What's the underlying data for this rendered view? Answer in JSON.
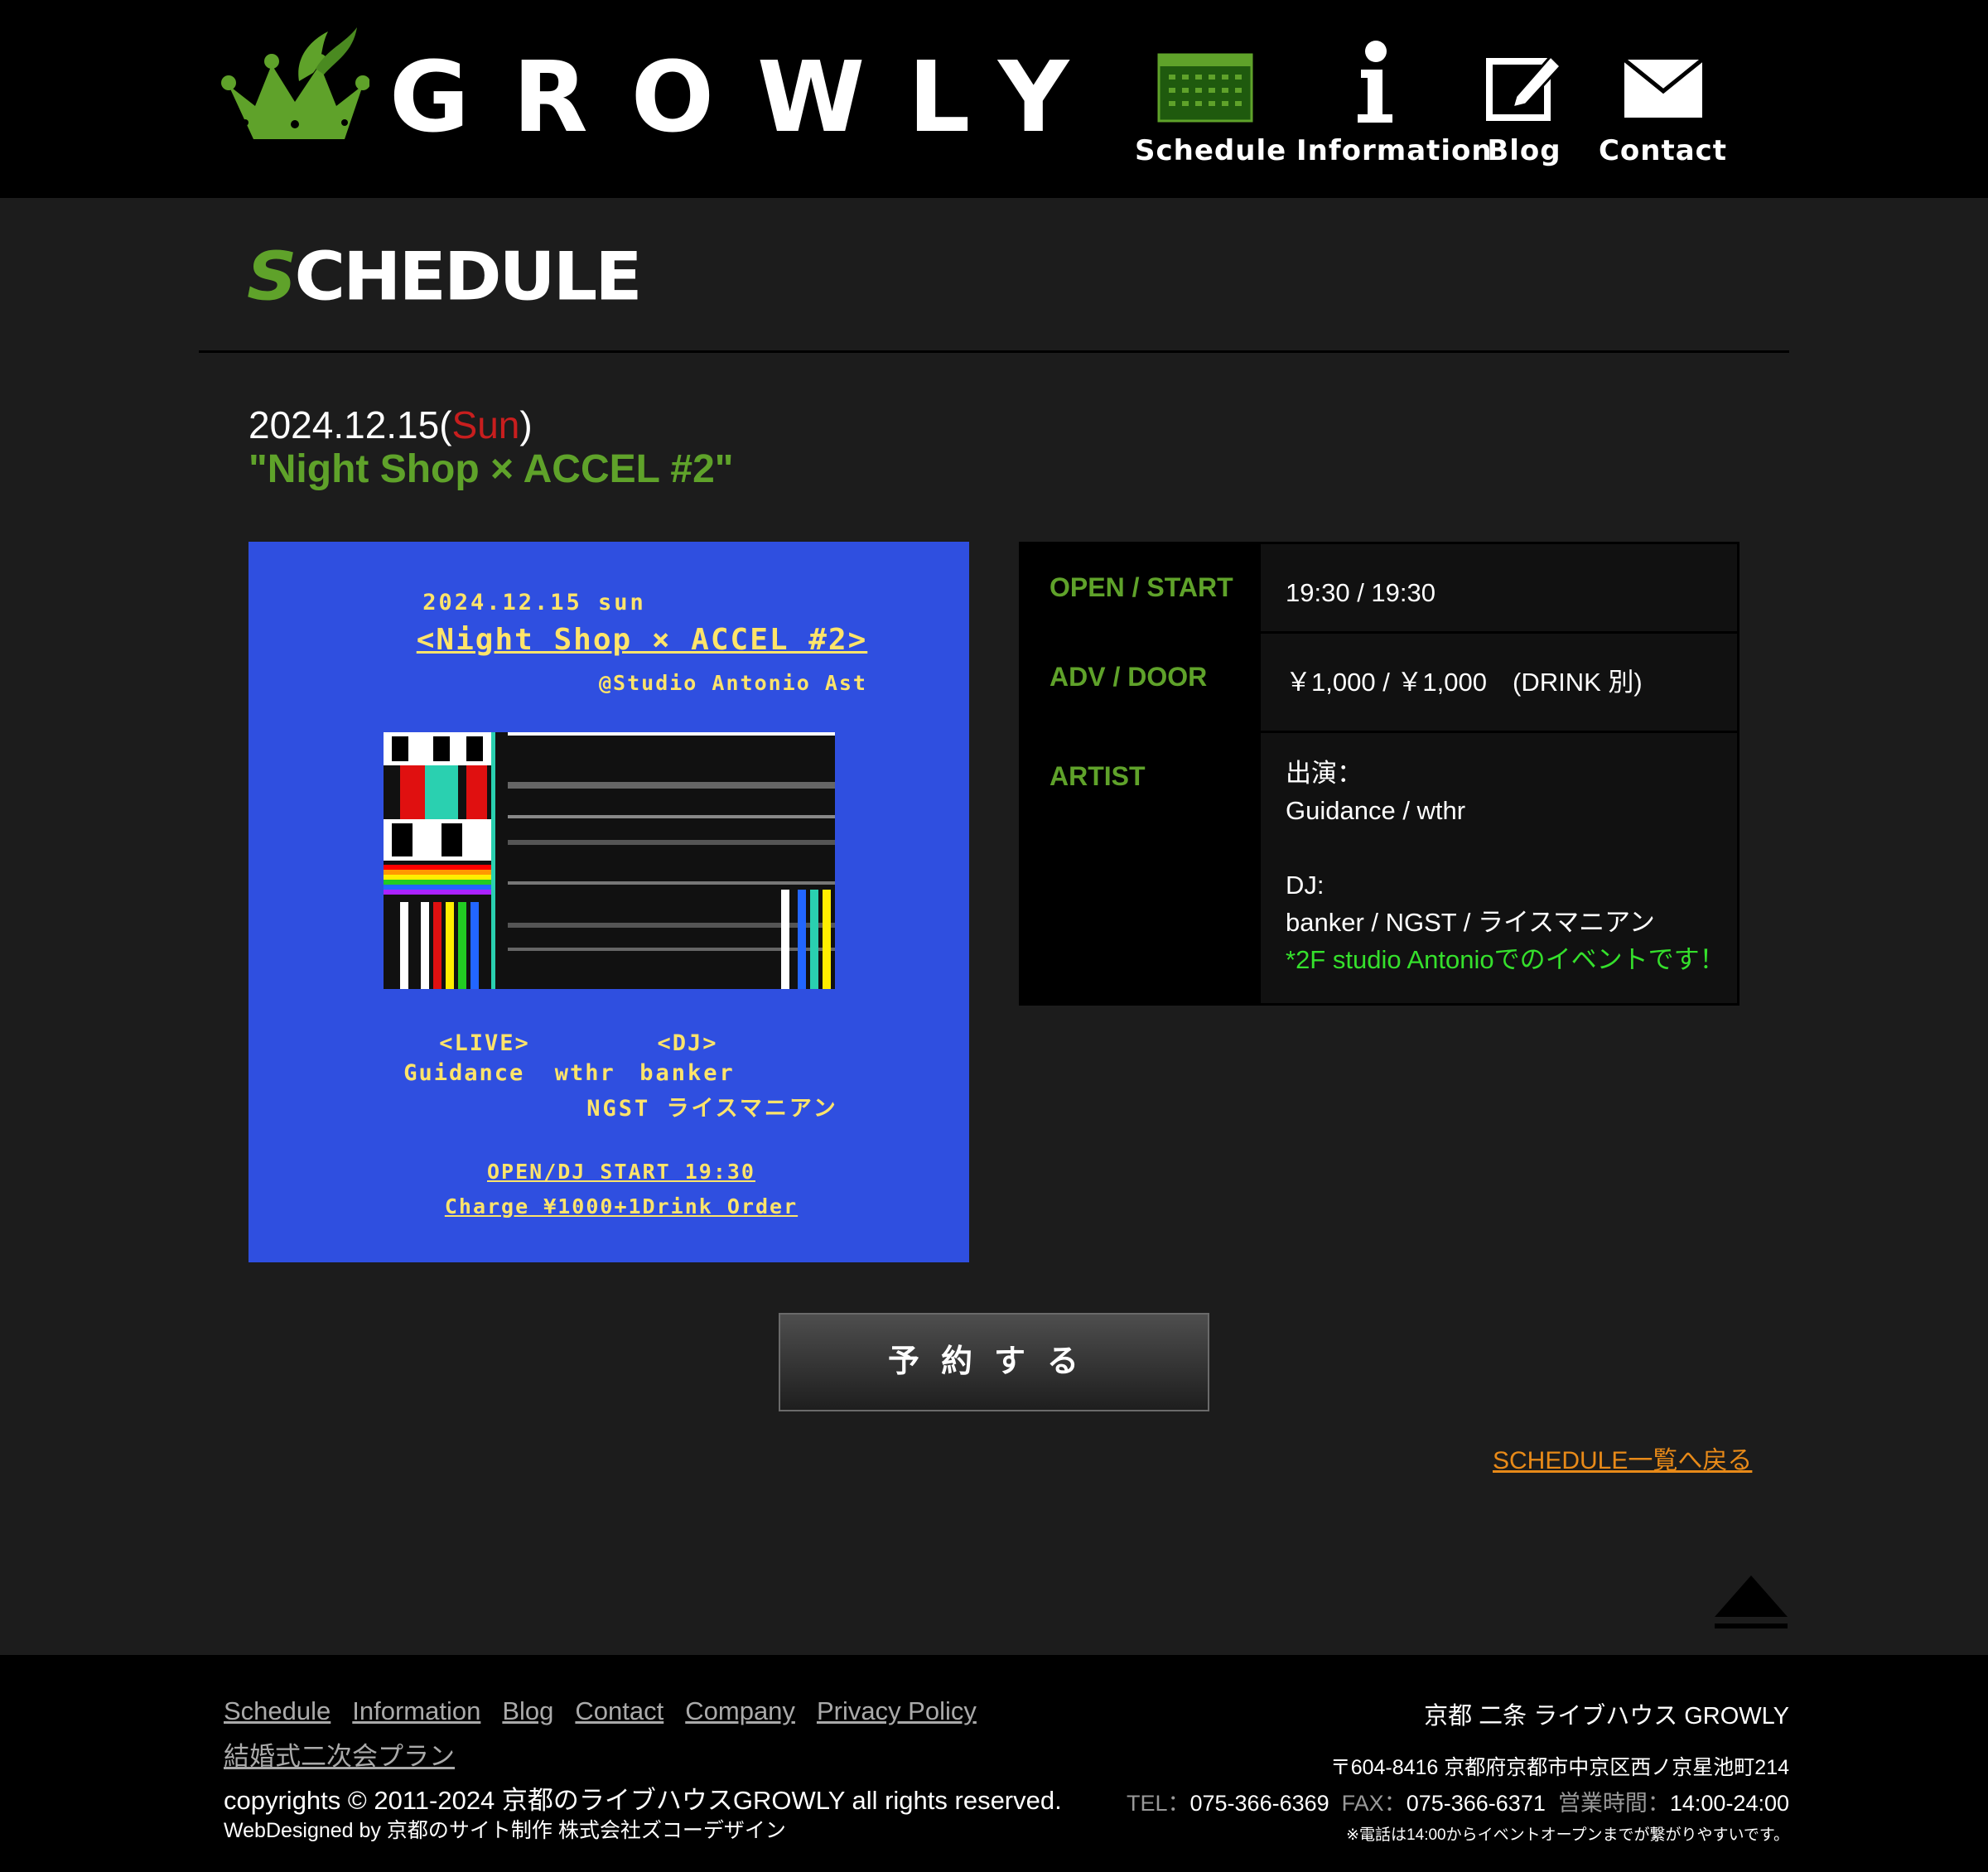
{
  "header": {
    "logo_text": "GROWLY",
    "nav": [
      {
        "label": "Schedule",
        "icon": "calendar-icon"
      },
      {
        "label": "Information",
        "icon": "info-icon"
      },
      {
        "label": "Blog",
        "icon": "pen-note-icon"
      },
      {
        "label": "Contact",
        "icon": "envelope-icon"
      }
    ]
  },
  "main": {
    "heading": "SCHEDULE",
    "date": "2024.12.15(",
    "day_of_week": "Sun",
    "date_close": ")",
    "event_title": "\"Night Shop × ACCEL #2\"",
    "flyer": {
      "date": "2024.12.15 sun",
      "title": "<Night Shop × ACCEL #2>",
      "venue": "@Studio Antonio Ast",
      "live_heading": "<LIVE>",
      "live_artists": "Guidance  wthr",
      "dj_heading": "<DJ>",
      "dj_line1": "banker",
      "dj_line2": "NGST ライスマニアン",
      "open": "OPEN/DJ START 19:30",
      "charge": "Charge ¥1000+1Drink Order"
    },
    "info": [
      {
        "label": "OPEN / START",
        "value": "19:30 / 19:30"
      },
      {
        "label": "ADV / DOOR",
        "value": "￥1,000 / ￥1,000　(DRINK 別)"
      },
      {
        "label": "ARTIST",
        "value": "出演：\nGuidance / wthr\n\nDJ:\nbanker / NGST / ライスマニアン\n",
        "note": "*2F studio Antonioでのイベントです！"
      }
    ],
    "reserve_label": "予約する",
    "back_link": "SCHEDULE一覧へ戻る"
  },
  "footer": {
    "links": [
      "Schedule",
      "Information",
      "Blog",
      "Contact",
      "Company",
      "Privacy Policy",
      "結婚式二次会プラン"
    ],
    "copyright": "copyrights © 2011-2024 京都のライブハウスGROWLY all rights reserved.",
    "webdesigned": "WebDesigned by 京都のサイト制作 株式会社ズコーデザイン",
    "venue": "京都 二条 ライブハウス GROWLY",
    "address": "〒604-8416 京都府京都市中京区西ノ京星池町214",
    "tel_label": "TEL：",
    "tel": "075-366-6369",
    "fax_label": "FAX：",
    "fax": "075-366-6371",
    "hours_label": "営業時間：",
    "hours": "14:00-24:00",
    "phone_note": "※電話は14:00からイベントオープンまでが繋がりやすいです。"
  },
  "colors": {
    "accent_green": "#5fa22a",
    "sunday_red": "#c81e1e",
    "link_orange": "#e88a18",
    "note_green": "#35e02c",
    "flyer_blue": "#2f4fe0",
    "flyer_yellow": "#ffe46a"
  }
}
